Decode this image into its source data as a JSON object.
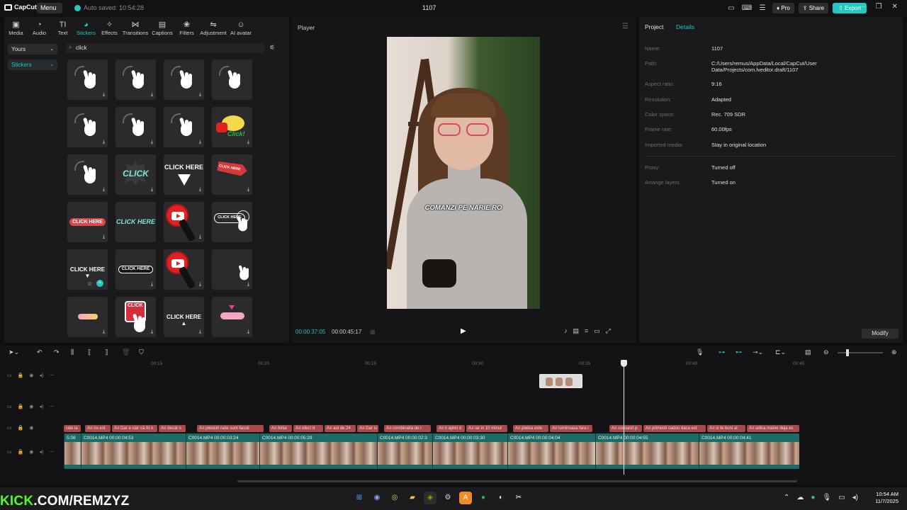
{
  "titlebar": {
    "app_name": "CapCut",
    "menu_label": "Menu",
    "autosave": "Auto saved: 10:54:28",
    "project_title": "1107",
    "pro_label": "Pro",
    "share_label": "Share",
    "export_label": "Export"
  },
  "toolbar": {
    "tabs": [
      "Media",
      "Audio",
      "Text",
      "Stickers",
      "Effects",
      "Transitions",
      "Captions",
      "Filters",
      "Adjustment",
      "AI avatar"
    ],
    "active_tab": "Stickers"
  },
  "sidebar": {
    "yours": "Yours",
    "stickers": "Stickers"
  },
  "search": {
    "value": "click"
  },
  "stickers": {
    "click_here": "CLICK HERE",
    "click_here_down": "CLICK HERE ▼",
    "click_here_up": "CLICK HERE ▲",
    "click": "CLICK",
    "click_burst": "CLICK",
    "click_script": "Click!"
  },
  "player": {
    "title": "Player",
    "caption": "COMANZI PE NARIE.RO",
    "current_time": "00:00:37:05",
    "total_time": "00:00:45:17"
  },
  "details": {
    "tab_project": "Project",
    "tab_details": "Details",
    "rows": [
      {
        "key": "Name:",
        "value": "1107"
      },
      {
        "key": "Path:",
        "value": "C:/Users/remus/AppData/Local/CapCut/User Data/Projects/com.lveditor.draft/1107"
      },
      {
        "key": "Aspect ratio:",
        "value": "9:16"
      },
      {
        "key": "Resolution:",
        "value": "Adapted"
      },
      {
        "key": "Color space:",
        "value": "Rec. 709 SDR"
      },
      {
        "key": "Frame rate:",
        "value": "60.00fps"
      },
      {
        "key": "Imported media:",
        "value": "Stay in original location"
      },
      {
        "key": "Proxy:",
        "value": "Turned off"
      },
      {
        "key": "Arrange layers",
        "value": "Turned on"
      }
    ],
    "modify_label": "Modify"
  },
  "timeline": {
    "ruler_labels": [
      "00:15",
      "00:20",
      "00:25",
      "00:30",
      "00:35",
      "00:40",
      "00:45"
    ],
    "text_clips": [
      "rate la",
      "A≡ ou est",
      "A≡ Dar e clar că AI o",
      "A≡ decat o",
      "A≡ plestuti nate sunt facuti",
      "A≡ birlai",
      "A≡ efect d",
      "A≡ aui de 24",
      "A≡ Dar si",
      "A≡ combinatia de l",
      "A≡ li aplici d",
      "A≡ iar in 10 minut",
      "A≡ pielea este",
      "A≡ luminoasa fara i",
      "A≡ comanzi p",
      "A≡ primesti cadou daca est",
      "A≡ si te buni ai",
      "A≡ adica maine deja es"
    ],
    "video_clips": [
      {
        "name": "",
        "duration": "5:08"
      },
      {
        "name": "C0014.MP4",
        "duration": "00:00:04:53"
      },
      {
        "name": "C0014.MP4",
        "duration": "00:00:03:24"
      },
      {
        "name": "C0014.MP4",
        "duration": "00:00:05:29"
      },
      {
        "name": "C0014.MP4",
        "duration": "00:00:02:3"
      },
      {
        "name": "C0014.MP4",
        "duration": "00:00:03:30"
      },
      {
        "name": "C0014.MP4",
        "duration": "00:00:04:04"
      },
      {
        "name": "C0014.MP4",
        "duration": "00:00:04:55"
      },
      {
        "name": "C0014.MP4",
        "duration": "00:00:04:41"
      }
    ]
  },
  "overlay": {
    "watermark_k": "KICK",
    "watermark_rest": ".COM/REMZYZ"
  },
  "taskbar": {
    "time": "10:54 AM",
    "date": "11/7/2025"
  }
}
